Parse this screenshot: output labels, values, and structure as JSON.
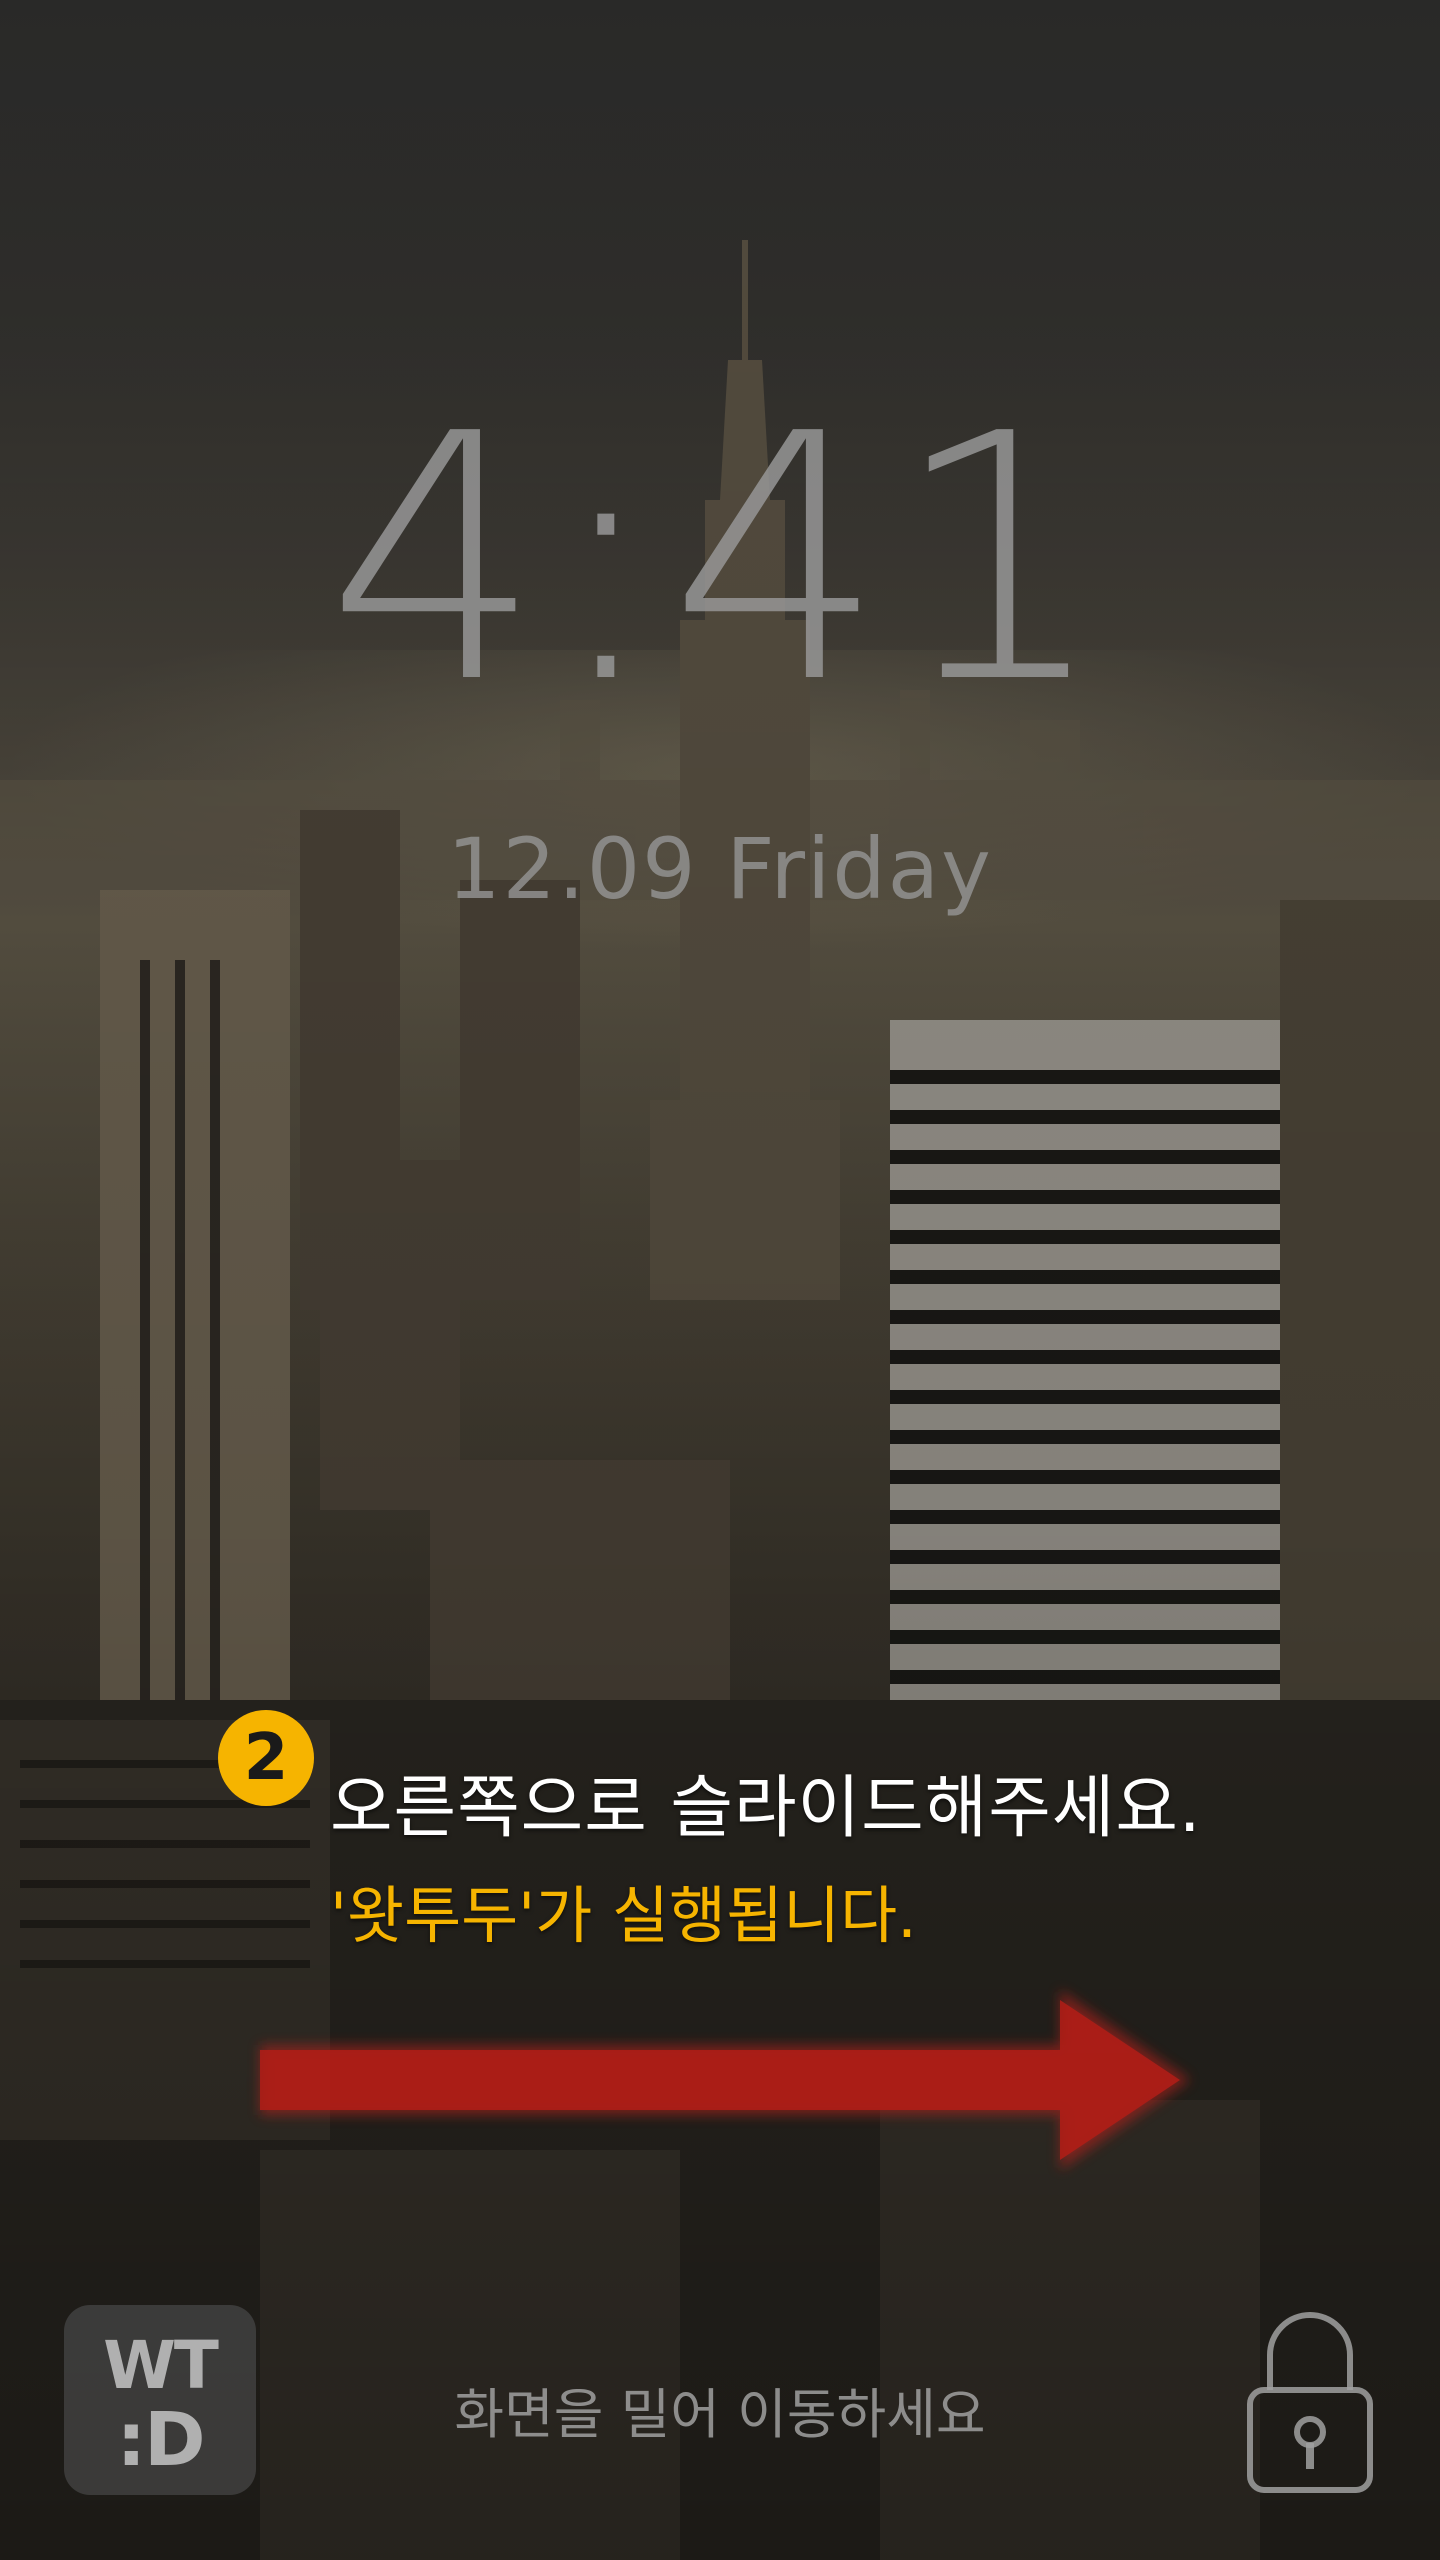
{
  "lockscreen": {
    "time": "4:41",
    "date": "12.09  Friday",
    "hint": "화면을 밀어 이동하세요"
  },
  "tutorial": {
    "step_number": "2",
    "line1": "오른쪽으로 슬라이드해주세요.",
    "line2": "'왓투두'가 실행됩니다."
  },
  "logo": {
    "line1": "WT",
    "line2": ":D"
  },
  "icons": {
    "arrow": "arrow-right-icon",
    "unlock": "unlock-icon"
  },
  "colors": {
    "accent_yellow": "#f6b400",
    "arrow_red": "#b31d16",
    "text_gray": "#969696"
  }
}
